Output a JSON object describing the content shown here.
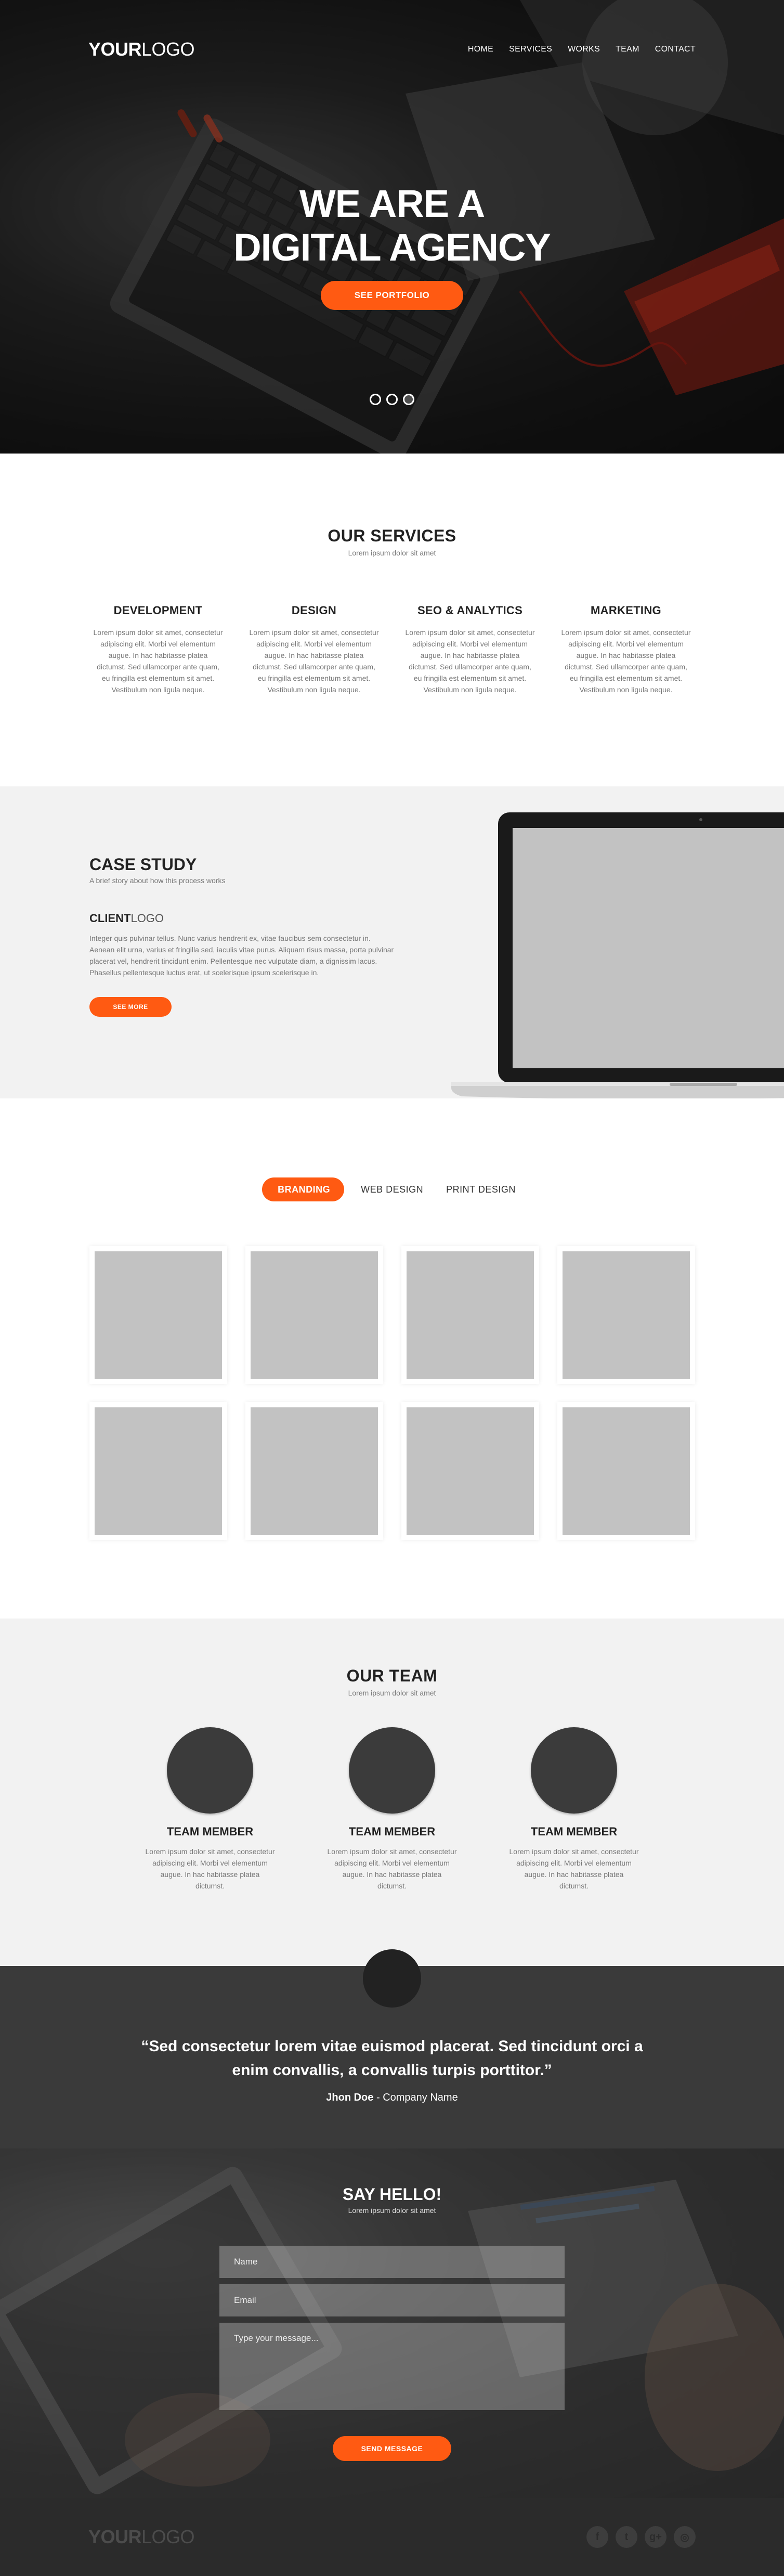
{
  "header": {
    "logo_bold": "YOUR",
    "logo_light": "LOGO",
    "nav": [
      "HOME",
      "SERVICES",
      "WORKS",
      "TEAM",
      "CONTACT"
    ]
  },
  "hero": {
    "title_line1": "WE ARE A",
    "title_line2": "DIGITAL AGENCY",
    "cta": "SEE PORTFOLIO",
    "slides": 3,
    "active_slide": 3
  },
  "services": {
    "title": "OUR SERVICES",
    "subtitle": "Lorem ipsum dolor sit amet",
    "items": [
      {
        "title": "DEVELOPMENT",
        "text": "Lorem ipsum dolor sit amet, consectetur adipiscing elit. Morbi vel elementum augue. In hac habitasse platea dictumst. Sed ullamcorper ante quam, eu fringilla est elementum sit amet. Vestibulum non ligula neque."
      },
      {
        "title": "DESIGN",
        "text": "Lorem ipsum dolor sit amet, consectetur adipiscing elit. Morbi vel elementum augue. In hac habitasse platea dictumst. Sed ullamcorper ante quam, eu fringilla est elementum sit amet. Vestibulum non ligula neque."
      },
      {
        "title": "SEO & ANALYTICS",
        "text": "Lorem ipsum dolor sit amet, consectetur adipiscing elit. Morbi vel elementum augue. In hac habitasse platea dictumst. Sed ullamcorper ante quam, eu fringilla est elementum sit amet. Vestibulum non ligula neque."
      },
      {
        "title": "MARKETING",
        "text": "Lorem ipsum dolor sit amet, consectetur adipiscing elit. Morbi vel elementum augue. In hac habitasse platea dictumst. Sed ullamcorper ante quam, eu fringilla est elementum sit amet. Vestibulum non ligula neque."
      }
    ]
  },
  "case_study": {
    "title": "CASE STUDY",
    "subtitle": "A brief story about how this process works",
    "client_bold": "CLIENT",
    "client_light": "LOGO",
    "description": "Integer quis pulvinar tellus. Nunc varius hendrerit ex, vitae faucibus sem consectetur in. Aenean elit urna, varius et fringilla sed, iaculis vitae purus. Aliquam risus massa, porta pulvinar placerat vel, hendrerit tincidunt enim. Pellentesque nec vulputate diam, a dignissim lacus. Phasellus pellentesque luctus erat, ut scelerisque ipsum scelerisque in.",
    "cta": "SEE MORE"
  },
  "portfolio": {
    "filters": [
      "BRANDING",
      "WEB DESIGN",
      "PRINT DESIGN"
    ],
    "active_filter": "BRANDING",
    "tiles": 8
  },
  "team": {
    "title": "OUR TEAM",
    "subtitle": "Lorem ipsum dolor sit amet",
    "members": [
      {
        "name": "TEAM MEMBER",
        "text": "Lorem ipsum dolor sit amet, consectetur adipiscing elit. Morbi vel elementum augue. In hac habitasse platea dictumst."
      },
      {
        "name": "TEAM MEMBER",
        "text": "Lorem ipsum dolor sit amet, consectetur adipiscing elit. Morbi vel elementum augue. In hac habitasse platea dictumst."
      },
      {
        "name": "TEAM MEMBER",
        "text": "Lorem ipsum dolor sit amet, consectetur adipiscing elit. Morbi vel elementum augue. In hac habitasse platea dictumst."
      }
    ]
  },
  "testimonial": {
    "quote": "“Sed consectetur lorem vitae euismod placerat. Sed tincidunt orci a enim convallis, a convallis turpis porttitor.”",
    "author": "Jhon Doe",
    "separator": " - ",
    "company": "Company Name"
  },
  "contact": {
    "title": "SAY HELLO!",
    "subtitle": "Lorem ipsum dolor sit amet",
    "name_placeholder": "Name",
    "email_placeholder": "Email",
    "message_placeholder": "Type your message...",
    "submit": "SEND MESSAGE"
  },
  "footer": {
    "logo_bold": "YOUR",
    "logo_light": "LOGO",
    "socials": [
      {
        "icon": "facebook-icon",
        "glyph": "f"
      },
      {
        "icon": "twitter-icon",
        "glyph": "t"
      },
      {
        "icon": "google-plus-icon",
        "glyph": "g+"
      },
      {
        "icon": "instagram-icon",
        "glyph": "◎"
      }
    ]
  },
  "colors": {
    "accent": "#ff5a12",
    "dark": "#3a3a3a",
    "light_bg": "#f2f2f2",
    "placeholder": "#c2c2c2"
  }
}
